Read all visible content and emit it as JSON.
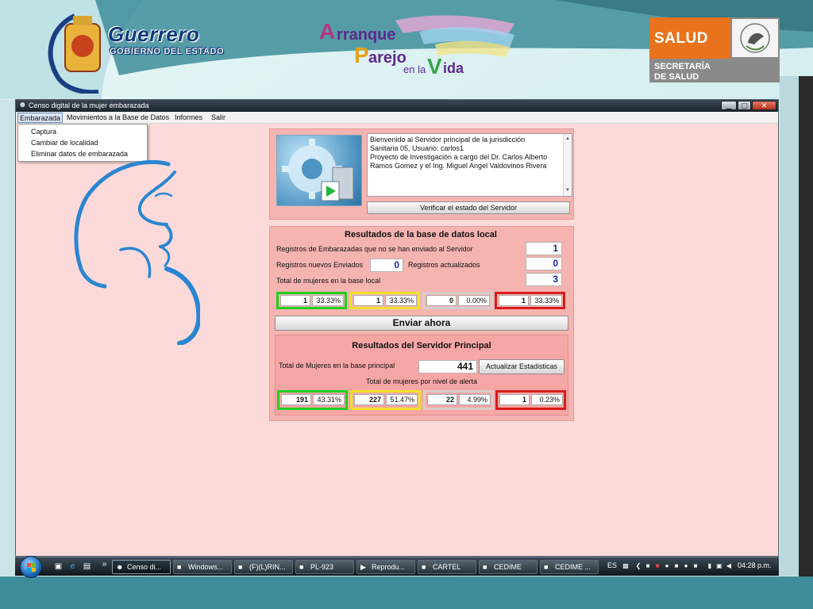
{
  "header": {
    "guerrero_title": "Guerrero",
    "guerrero_subtitle": "GOBIERNO DEL ESTADO",
    "arranque_line1": "rranque",
    "arranque_initial_a": "A",
    "arranque_initial_p": "P",
    "arranque_line2": "arejo",
    "arranque_line3": "en la",
    "arranque_initial_v": "V",
    "arranque_line4": "ida",
    "salud_word": "SALUD",
    "salud_sub1": "SECRETARÍA",
    "salud_sub2": "DE SALUD"
  },
  "window": {
    "title": "Censo digital de la mujer embarazada",
    "min_label": "▁",
    "max_label": "▢",
    "close_label": "✕"
  },
  "menu": {
    "items": [
      {
        "label": "Embarazada"
      },
      {
        "label": "Movimientos a la Base de Datos"
      },
      {
        "label": "Informes"
      },
      {
        "label": "Salir"
      }
    ],
    "dropdown": [
      {
        "label": "Captura"
      },
      {
        "label": "Cambiar de localidad"
      },
      {
        "label": "Eliminar datos de embarazada"
      }
    ]
  },
  "server_panel": {
    "message_lines": [
      "Bienvenido al Servidor principal de la jurisdicción",
      "Sanitaria 05, Usuario: carlos1",
      "Proyecto de Investigación a cargo del Dr. Carlos Alberto",
      "Ramos Gomez y el Ing. Miguel Angel Valdovinos Rivera"
    ],
    "verify_button": "Verificar el estado del Servidor"
  },
  "local_db": {
    "title": "Resultados de la base de datos local",
    "not_sent_label": "Registros de Embarazadas que no se han enviado al Servidor",
    "not_sent_value": "1",
    "new_sent_label": "Registros nuevos Enviados",
    "new_sent_value": "0",
    "updated_label": "Registros actualizados",
    "updated_value": "0",
    "total_label": "Total de mujeres en la base local",
    "total_value": "3",
    "levels": [
      {
        "count": "1",
        "pct": "33.33%",
        "color": "#1fcf1f"
      },
      {
        "count": "1",
        "pct": "33.33%",
        "color": "#f0e22a"
      },
      {
        "count": "0",
        "pct": "0.00%",
        "color": "#d9cccc"
      },
      {
        "count": "1",
        "pct": "33.33%",
        "color": "#d81b1b"
      }
    ],
    "send_button": "Enviar ahora"
  },
  "main_server": {
    "title": "Resultados del Servidor Principal",
    "total_label": "Total de Mujeres en la base principal",
    "total_value": "441",
    "update_button": "Actualizar Estadisticas",
    "alert_label": "Total de mujeres por nivel de alerta",
    "levels": [
      {
        "count": "191",
        "pct": "43.31%",
        "color": "#1fcf1f"
      },
      {
        "count": "227",
        "pct": "51.47%",
        "color": "#f0e22a"
      },
      {
        "count": "22",
        "pct": "4.99%",
        "color": "#d9cccc"
      },
      {
        "count": "1",
        "pct": "0.23%",
        "color": "#d81b1b"
      }
    ]
  },
  "taskbar": {
    "more_label": "»",
    "buttons": [
      {
        "label": "Censo di..."
      },
      {
        "label": "Windows..."
      },
      {
        "label": "(F)(L)RIN..."
      },
      {
        "label": "PL-923"
      },
      {
        "label": "Reprodu..."
      },
      {
        "label": "CARTEL"
      },
      {
        "label": "CEDIME"
      },
      {
        "label": "CEDIME ..."
      }
    ],
    "language": "ES",
    "clock": "04:28 p.m."
  }
}
